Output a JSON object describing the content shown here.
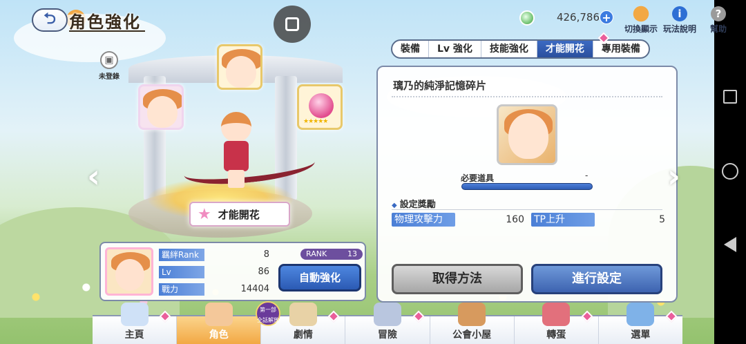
{
  "header": {
    "title": "角色強化",
    "back_icon": "back-arrow-icon",
    "gems": "426,786",
    "gem_plus": "+",
    "switch_label": "切換顯示",
    "help_label": "玩法說明",
    "info_label": "幫助",
    "info_glyph": "i",
    "help_glyph": "?"
  },
  "tabs": [
    {
      "label": "裝備"
    },
    {
      "label": "Lv 強化"
    },
    {
      "label": "技能強化"
    },
    {
      "label": "才能開花"
    },
    {
      "label": "專用裝備"
    }
  ],
  "active_tab": 3,
  "panel": {
    "title": "璃乃的純淨記憶碎片",
    "required_label": "必要道具",
    "required_value": "-",
    "reward_header": "設定獎勵",
    "reward_marker": "◆",
    "stats": [
      {
        "label": "物理攻擊力",
        "value": "160"
      },
      {
        "label": "TP上升",
        "value": "5"
      }
    ],
    "obtain_button": "取得方法",
    "set_button": "進行設定"
  },
  "character": {
    "unregistered": "未登錄",
    "talent_button": "才能開花",
    "stars": "★★★★★"
  },
  "info": {
    "bond_label": "羈絆Rank",
    "bond_value": "8",
    "lv_label": "Lv",
    "lv_value": "86",
    "power_label": "戰力",
    "power_value": "14404",
    "rank_label": "RANK",
    "rank_value": "13",
    "auto_button": "自動強化"
  },
  "bottom_nav": [
    {
      "label": "主頁"
    },
    {
      "label": "角色"
    },
    {
      "label": "劇情"
    },
    {
      "label": "冒險"
    },
    {
      "label": "公會小屋"
    },
    {
      "label": "轉蛋"
    },
    {
      "label": "選單"
    }
  ],
  "new_badge": "第一部\n全話解放",
  "colors": {
    "accent_blue": "#2a4f9e",
    "badge_pink": "#ea5f9b",
    "active_orange": "#f2a844"
  }
}
